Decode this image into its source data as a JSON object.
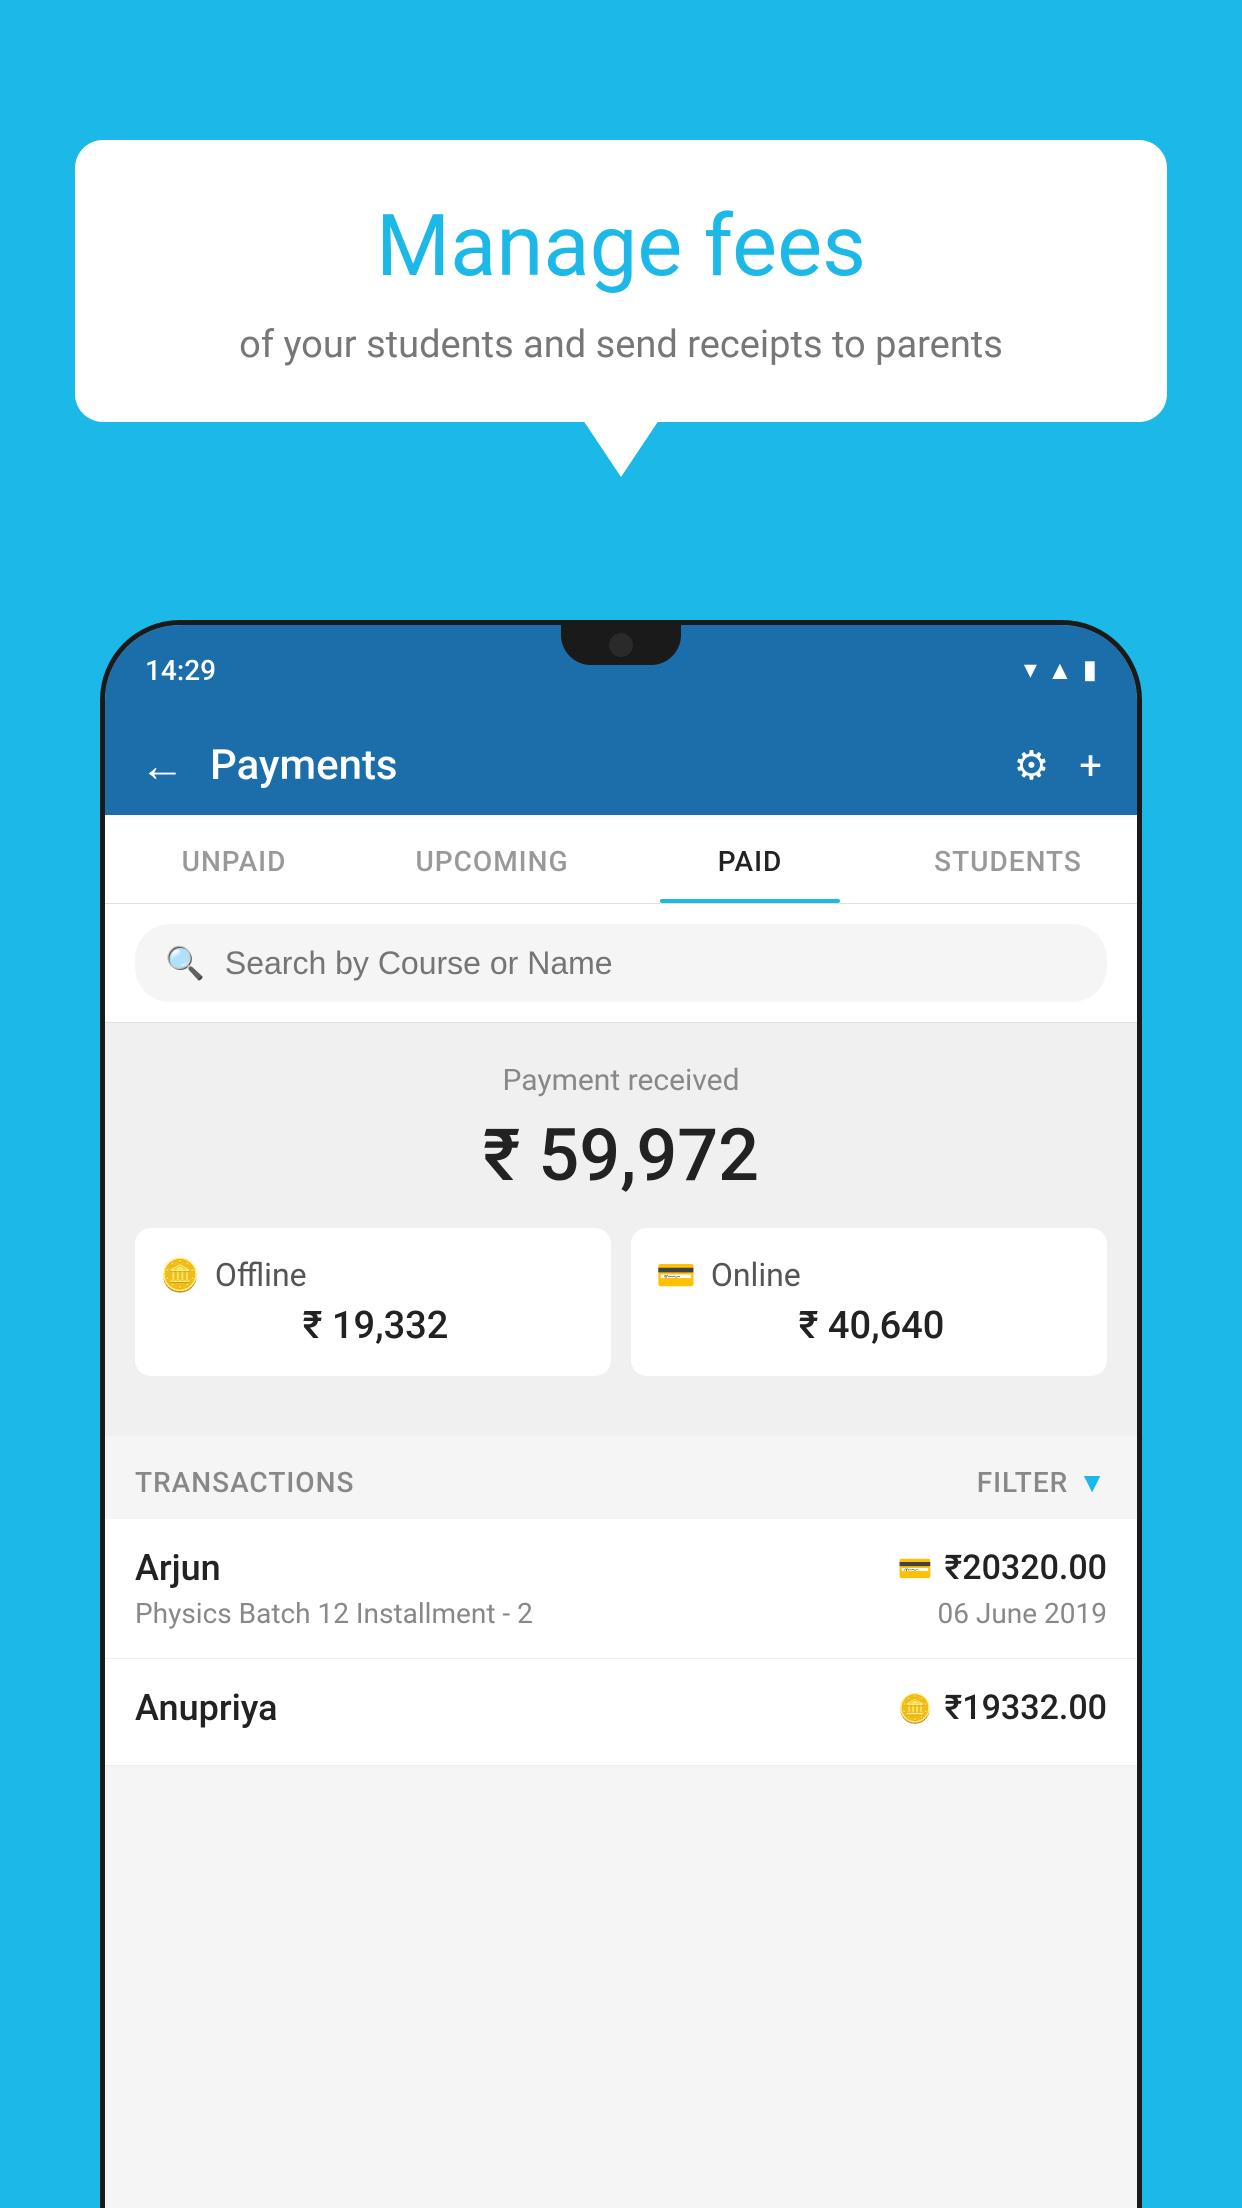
{
  "background_color": "#1bb8e8",
  "speech_bubble": {
    "title": "Manage fees",
    "subtitle": "of your students and send receipts to parents"
  },
  "status_bar": {
    "time": "14:29",
    "wifi_icon": "wifi",
    "signal_icon": "signal",
    "battery_icon": "battery"
  },
  "app_header": {
    "title": "Payments",
    "back_label": "←",
    "settings_icon": "⚙",
    "add_icon": "+"
  },
  "tabs": [
    {
      "label": "UNPAID",
      "active": false
    },
    {
      "label": "UPCOMING",
      "active": false
    },
    {
      "label": "PAID",
      "active": true
    },
    {
      "label": "STUDENTS",
      "active": false
    }
  ],
  "search": {
    "placeholder": "Search by Course or Name"
  },
  "payment_summary": {
    "label": "Payment received",
    "total": "₹ 59,972",
    "offline": {
      "type": "Offline",
      "amount": "₹ 19,332"
    },
    "online": {
      "type": "Online",
      "amount": "₹ 40,640"
    }
  },
  "transactions_section": {
    "label": "TRANSACTIONS",
    "filter_label": "FILTER"
  },
  "transactions": [
    {
      "name": "Arjun",
      "course": "Physics Batch 12 Installment - 2",
      "amount": "₹20320.00",
      "date": "06 June 2019",
      "method": "online"
    },
    {
      "name": "Anupriya",
      "course": "",
      "amount": "₹19332.00",
      "date": "",
      "method": "offline"
    }
  ]
}
